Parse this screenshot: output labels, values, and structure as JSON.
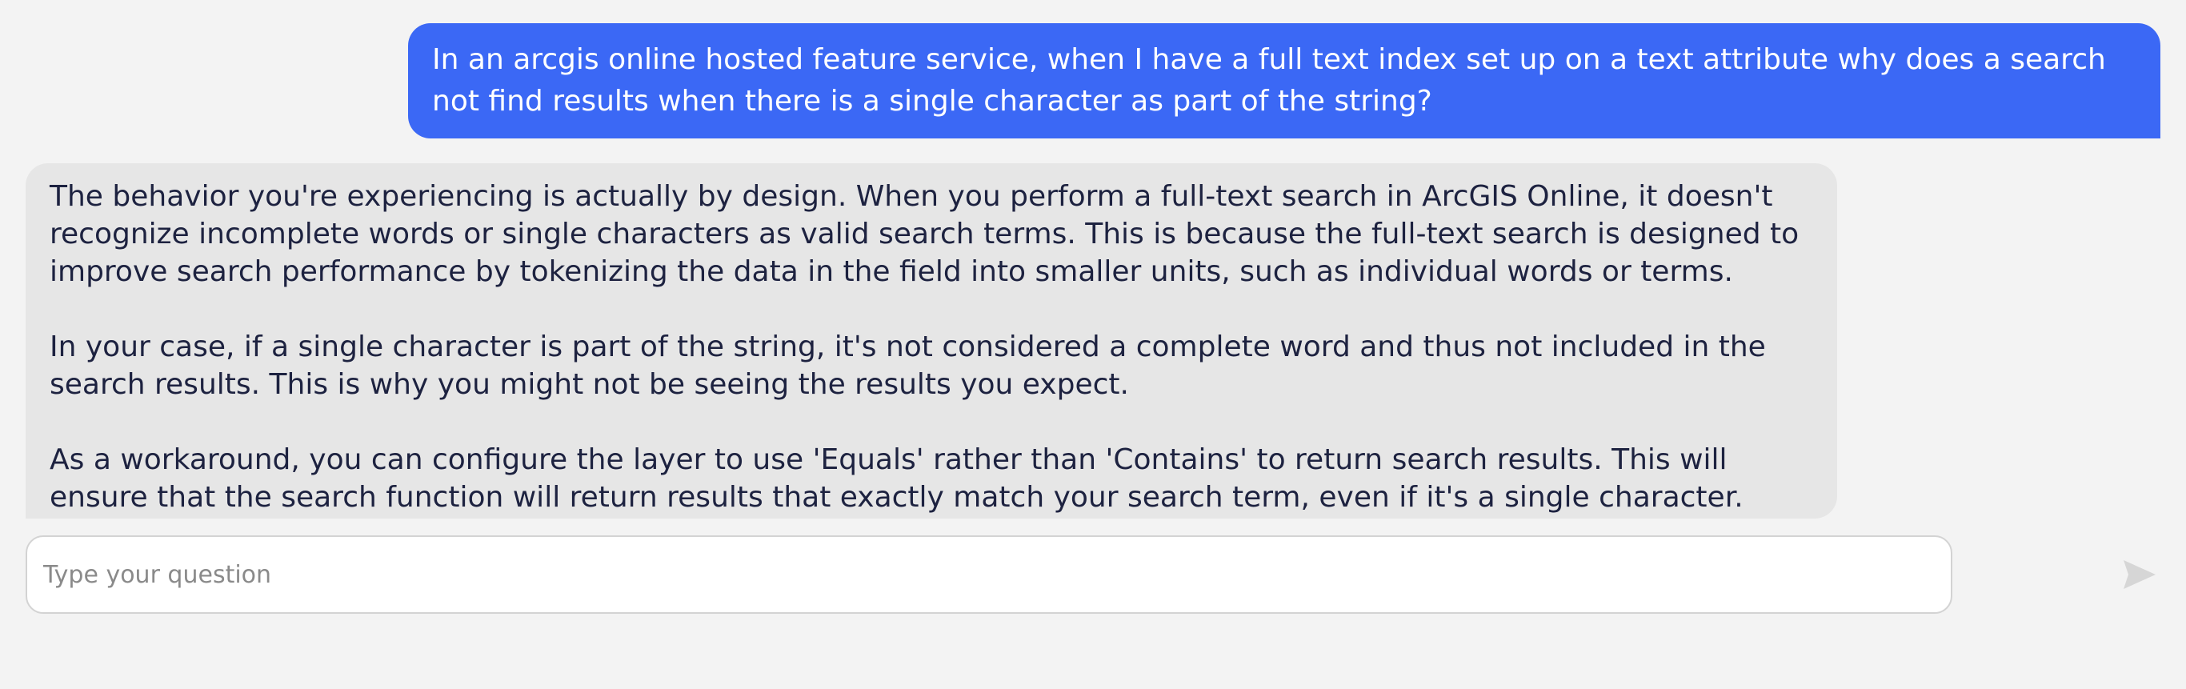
{
  "conversation": {
    "user_message": "In an arcgis online hosted feature service, when I have a full text index set up on a text attribute why does a search not find results when there is a single character as part of the string?",
    "assistant_paragraphs": [
      "The behavior you're experiencing is actually by design. When you perform a full-text search in ArcGIS Online, it doesn't recognize incomplete words or single characters as valid search terms. This is because the full-text search is designed to improve search performance by tokenizing the data in the field into smaller units, such as individual words or terms.",
      "In your case, if a single character is part of the string, it's not considered a complete word and thus not included in the search results. This is why you might not be seeing the results you expect.",
      "As a workaround, you can configure the layer to use 'Equals' rather than 'Contains' to return search results. This will ensure that the search function will return results that exactly match your search term, even if it's a single character."
    ]
  },
  "composer": {
    "placeholder": "Type your question",
    "value": "",
    "send_icon": "send-icon"
  },
  "colors": {
    "user_bubble": "#3b68f5",
    "assistant_bubble": "#e6e6e6",
    "background": "#f3f3f3",
    "send_icon_disabled": "#d6d6d6"
  }
}
